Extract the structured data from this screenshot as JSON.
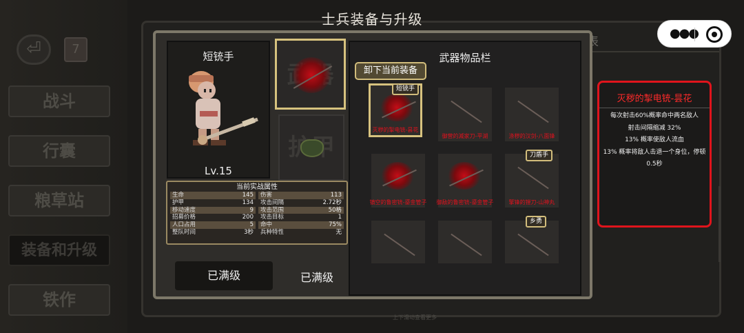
{
  "title": "士兵装备与升级",
  "background": {
    "sidebar": [
      "战斗",
      "行囊",
      "粮草站",
      "装备和升级",
      "铁作"
    ],
    "calendar": "7",
    "tab_partial": "表",
    "hint": "上下滑动查看更多"
  },
  "unit": {
    "name": "短铳手",
    "level": "Lv.15"
  },
  "stats": {
    "title": "当前实战属性",
    "rows": [
      {
        "k": "生命",
        "v": "145"
      },
      {
        "k": "伤害",
        "v": "113"
      },
      {
        "k": "护甲",
        "v": "134"
      },
      {
        "k": "攻击间隔",
        "v": "2.72秒"
      },
      {
        "k": "移动速度",
        "v": "9"
      },
      {
        "k": "攻击范围",
        "v": "50格"
      },
      {
        "k": "招募价格",
        "v": "200"
      },
      {
        "k": "攻击目标",
        "v": "1"
      },
      {
        "k": "人口占用",
        "v": "5"
      },
      {
        "k": "命中",
        "v": "75%"
      },
      {
        "k": "整队时间",
        "v": "3秒"
      },
      {
        "k": "兵种特性",
        "v": "无"
      }
    ]
  },
  "slots": {
    "weapon_watermark": "武器",
    "armor_watermark": "护甲"
  },
  "upgrade": {
    "button": "已满级",
    "status": "已满级"
  },
  "inventory": {
    "title": "武器物品栏",
    "unequip": "卸下当前装备",
    "items": [
      {
        "name": "灭秽的掣电铳-昙花",
        "tag": "短铳手"
      },
      {
        "name": "御营的滅家刀-平湖",
        "tag": ""
      },
      {
        "name": "涤秽的汉剑-八面锋",
        "tag": ""
      },
      {
        "name": "镇空的鲁密铳-鎏金管子",
        "tag": ""
      },
      {
        "name": "御敌的鲁密铳-鎏金管子",
        "tag": ""
      },
      {
        "name": "擎锋的镗刀-山神丸",
        "tag": "刀盾手"
      },
      {
        "name": "",
        "tag": ""
      },
      {
        "name": "",
        "tag": ""
      },
      {
        "name": "",
        "tag": "乡勇"
      }
    ]
  },
  "detail": {
    "title": "灭秽的掣电铳-昙花",
    "lines": [
      "每次射击60%概率命中两名敌人",
      "射击间隔缩减 32%",
      "13% 概率使敌人流血",
      "13% 概率将敌人击退一个身位，停顿0.5秒"
    ]
  },
  "colors": {
    "frame_gold": "#d2bd7c",
    "highlight_red": "#e0141c",
    "item_name_red": "#e2111d"
  }
}
